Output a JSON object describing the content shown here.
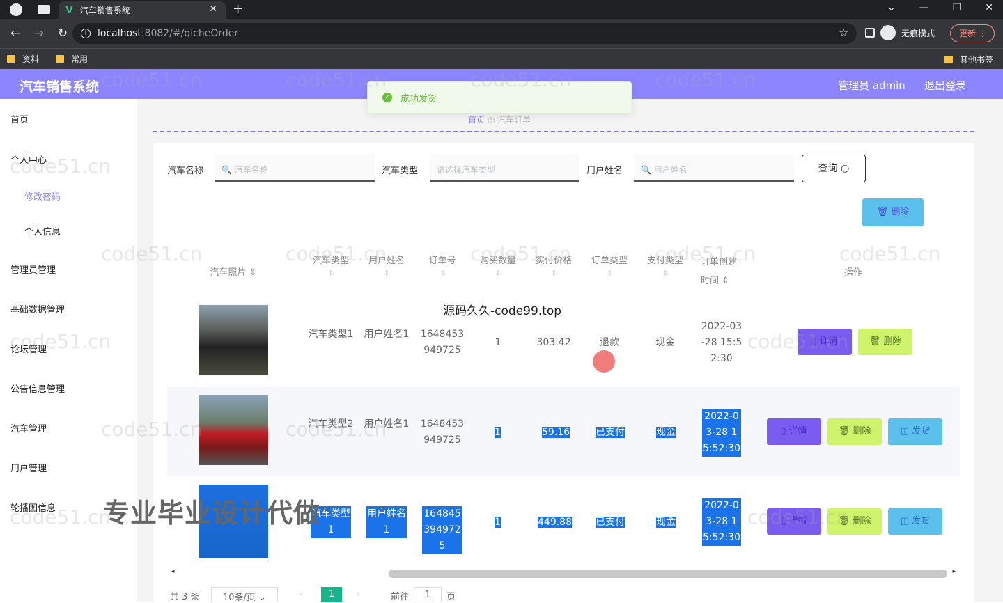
{
  "browser": {
    "tab_title": "汽车销售系统",
    "url_host": "localhost",
    "url_path": ":8082/#/qicheOrder",
    "profile": "无痕模式",
    "update": "更新",
    "bookmarks": [
      "资料",
      "常用"
    ],
    "other_bookmarks": "其他书签"
  },
  "header": {
    "title": "汽车销售系统",
    "admin": "管理员 admin",
    "logout": "退出登录"
  },
  "toast": "成功发货",
  "breadcrumb": {
    "home": "首页",
    "current": "汽车订单"
  },
  "sidebar": {
    "home": "首页",
    "personal": "个人中心",
    "change_pwd": "修改密码",
    "profile": "个人信息",
    "admin_mgmt": "管理员管理",
    "base_data": "基础数据管理",
    "forum": "论坛管理",
    "notice": "公告信息管理",
    "car": "汽车管理",
    "user": "用户管理",
    "carousel": "轮播图信息"
  },
  "search": {
    "car_name_label": "汽车名称",
    "car_name_ph": "汽车名称",
    "car_type_label": "汽车类型",
    "car_type_ph": "请选择汽车类型",
    "user_label": "用户姓名",
    "user_ph": "用户姓名",
    "query": "查询",
    "delete": "删除"
  },
  "table": {
    "headers": [
      "汽车照片",
      "汽车类型",
      "用户姓名",
      "订单号",
      "购买数量",
      "实付价格",
      "订单类型",
      "支付类型",
      "订单创建时间",
      "操作"
    ],
    "rows": [
      {
        "type": "汽车类型1",
        "user": "用户姓名1",
        "order": "1648453949725",
        "qty": "1",
        "price": "303.42",
        "otype": "退款",
        "pay": "现金",
        "time": "2022-03-28 15:52:30"
      },
      {
        "type": "汽车类型2",
        "user": "用户姓名1",
        "order": "1648453949725",
        "qty": "1",
        "price": "59.16",
        "otype": "已支付",
        "pay": "现金",
        "time": "2022-03-28 15:52:30"
      },
      {
        "type": "汽车类型1",
        "user": "用户姓名1",
        "order": "1648453949725",
        "qty": "1",
        "price": "449.88",
        "otype": "已支付",
        "pay": "现金",
        "time": "2022-03-28 15:52:30"
      }
    ],
    "btn_detail": "详情",
    "btn_delete": "删除",
    "btn_ship": "发货"
  },
  "pager": {
    "total": "共 3 条",
    "size": "10条/页",
    "current": "1",
    "goto": "前往",
    "goto_val": "1",
    "page": "页"
  },
  "watermark": "code51.cn",
  "caption": "源码久久-code99.top",
  "promo": "专业毕业设计代做"
}
